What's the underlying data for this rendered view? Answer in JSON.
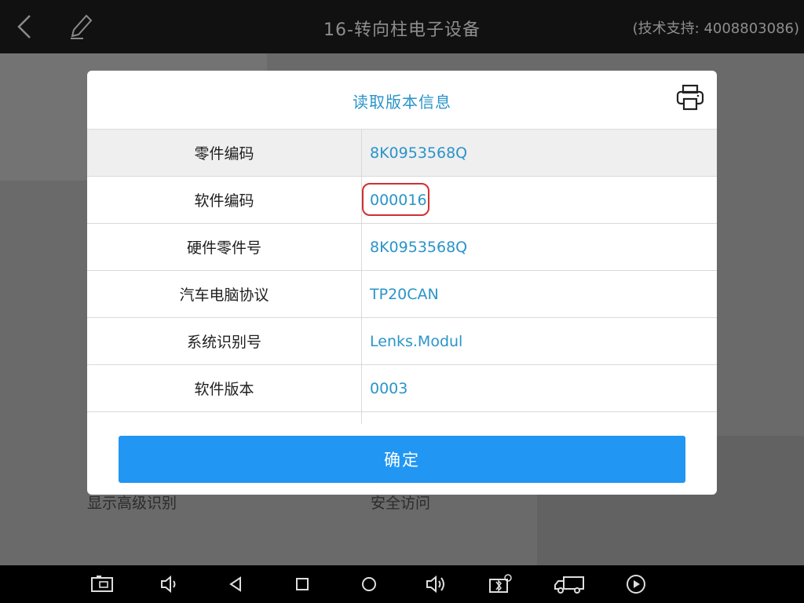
{
  "header": {
    "title": "16-转向柱电子设备",
    "support": "(技术支持: 4008803086)"
  },
  "background": {
    "left_label": "显示高级识别",
    "right_label": "安全访问"
  },
  "dialog": {
    "title": "读取版本信息",
    "rows": [
      {
        "label": "零件编码",
        "value": "8K0953568Q"
      },
      {
        "label": "软件编码",
        "value": "000016"
      },
      {
        "label": "硬件零件号",
        "value": "8K0953568Q"
      },
      {
        "label": "汽车电脑协议",
        "value": "TP20CAN"
      },
      {
        "label": "系统识别号",
        "value": "Lenks.Modul"
      },
      {
        "label": "软件版本",
        "value": "0003"
      },
      {
        "label": "",
        "value": ""
      }
    ],
    "confirm_label": "确定"
  },
  "navbar": {
    "icons": [
      "screenshot-icon",
      "volume-down-icon",
      "back-triangle-icon",
      "recent-apps-icon",
      "home-circle-icon",
      "volume-up-icon",
      "vci-bluetooth-icon",
      "truck-icon",
      "play-icon"
    ]
  },
  "colors": {
    "accent": "#2a94c9",
    "button": "#2196f3",
    "annotation": "#d03030"
  }
}
